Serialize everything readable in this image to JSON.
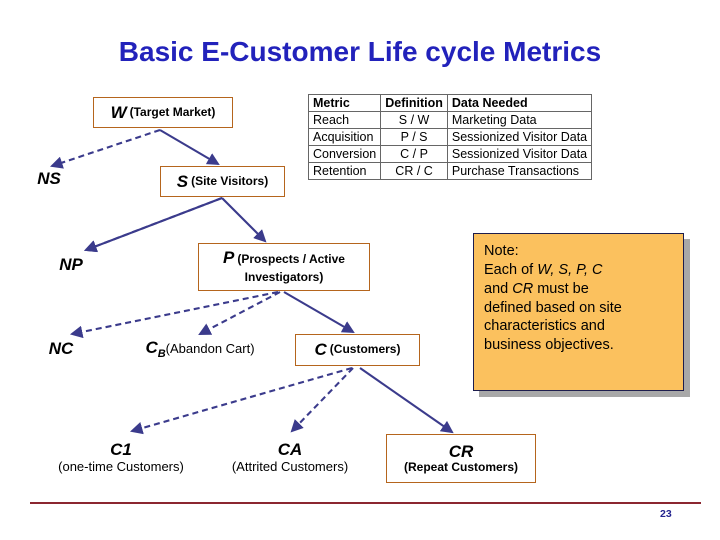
{
  "slide": {
    "title": "Basic E-Customer Life cycle Metrics",
    "page_number": "23",
    "title_color": "#2222bb",
    "arrow_color": "#3b3b8c",
    "box_border_color": "#b5651d",
    "note_bg_color": "#fbc15e",
    "footer_rule_color": "#8b2630"
  },
  "diagram": {
    "nodes": {
      "w": {
        "symbol": "W",
        "desc": "(Target Market)"
      },
      "ns": {
        "symbol": "NS",
        "desc": ""
      },
      "s": {
        "symbol": "S",
        "desc": "(Site Visitors)"
      },
      "np": {
        "symbol": "NP",
        "desc": ""
      },
      "p": {
        "symbol": "P",
        "desc": "(Prospects / Active Investigators)"
      },
      "nc": {
        "symbol": "NC",
        "desc": ""
      },
      "cb": {
        "symbol": "C",
        "subscript": "B",
        "desc": "(Abandon Cart)"
      },
      "c": {
        "symbol": "C",
        "desc": "(Customers)"
      },
      "c1": {
        "symbol": "C1",
        "desc": "(one-time Customers)"
      },
      "ca": {
        "symbol": "CA",
        "desc": "(Attrited Customers)"
      },
      "cr": {
        "symbol": "CR",
        "desc": "(Repeat Customers)"
      }
    }
  },
  "metric_table": {
    "headers": [
      "Metric",
      "Definition",
      "Data Needed"
    ],
    "rows": [
      [
        "Reach",
        "S / W",
        "Marketing Data"
      ],
      [
        "Acquisition",
        "P / S",
        "Sessionized Visitor Data"
      ],
      [
        "Conversion",
        "C / P",
        "Sessionized Visitor Data"
      ],
      [
        "Retention",
        "CR / C",
        "Purchase Transactions"
      ]
    ]
  },
  "note": {
    "heading": "Note:",
    "line1_pre": "Each of ",
    "line1_italic": "W, S, P, C",
    "line2_pre": "and ",
    "line2_italic": "CR",
    "line2_post": " must be",
    "line3": "defined based on site",
    "line4": "characteristics and",
    "line5": "business objectives."
  }
}
